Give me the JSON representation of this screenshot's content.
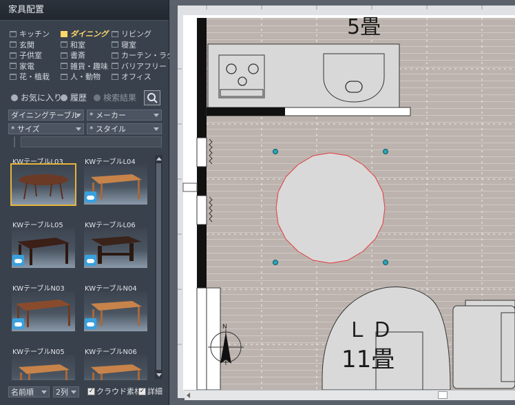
{
  "panel": {
    "title": "家具配置",
    "categories": [
      {
        "label": "キッチン",
        "active": false
      },
      {
        "label": "ダイニング",
        "active": true
      },
      {
        "label": "リビング",
        "active": false
      },
      {
        "label": "玄関",
        "active": false
      },
      {
        "label": "和室",
        "active": false
      },
      {
        "label": "寝室",
        "active": false
      },
      {
        "label": "子供室",
        "active": false
      },
      {
        "label": "書斎",
        "active": false
      },
      {
        "label": "カーテン・ラグ",
        "active": false
      },
      {
        "label": "家電",
        "active": false
      },
      {
        "label": "雑貨・趣味",
        "active": false
      },
      {
        "label": "バリアフリー",
        "active": false
      },
      {
        "label": "花・植栽",
        "active": false
      },
      {
        "label": "人・動物",
        "active": false
      },
      {
        "label": "オフィス",
        "active": false
      }
    ],
    "quick": {
      "favorites": "お気に入り",
      "history": "履歴",
      "results": "検索結果"
    },
    "filters": {
      "type": "ダイニングテーブル",
      "maker": "* メーカー",
      "size": "* サイズ",
      "style": "* スタイル"
    },
    "items": [
      {
        "label": "KWテーブルL03",
        "cloud": false,
        "selected": true,
        "style": "oval"
      },
      {
        "label": "KWテーブルL04",
        "cloud": true,
        "selected": false,
        "style": "rect-light"
      },
      {
        "label": "KWテーブルL05",
        "cloud": true,
        "selected": false,
        "style": "rect-dark"
      },
      {
        "label": "KWテーブルL06",
        "cloud": true,
        "selected": false,
        "style": "trestle-dark"
      },
      {
        "label": "KWテーブルN03",
        "cloud": true,
        "selected": false,
        "style": "rect-mid"
      },
      {
        "label": "KWテーブルN04",
        "cloud": true,
        "selected": false,
        "style": "rect-light"
      },
      {
        "label": "KWテーブルN05",
        "cloud": false,
        "selected": false,
        "style": "rect-light"
      },
      {
        "label": "KWテーブルN06",
        "cloud": false,
        "selected": false,
        "style": "rect-light"
      }
    ],
    "bottom": {
      "sort": "名前順",
      "columns": "2列",
      "cloud_label": "クラウド素材",
      "detail_label": "詳細"
    }
  },
  "floorplan": {
    "room_top": "5畳",
    "room_ld_name": "ＬＤ",
    "room_ld_size": "11畳",
    "compass": "N"
  },
  "colors": {
    "floor": "#bcb3ae",
    "table_outline": "#e23a3a",
    "handle": "#2aa3b3",
    "active_category": "#ffd86a",
    "selected_item": "#e8b43a"
  }
}
